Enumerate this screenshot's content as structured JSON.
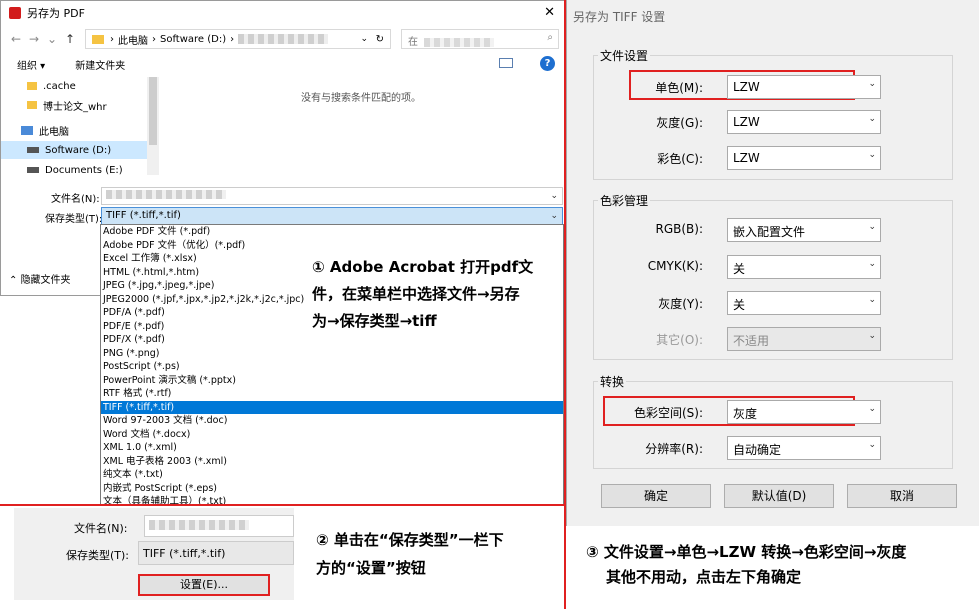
{
  "save_dialog": {
    "title": "另存为 PDF",
    "breadcrumb": [
      "此电脑",
      "Software (D:)"
    ],
    "search_prefix": "在",
    "organize": "组织",
    "new_folder": "新建文件夹",
    "help_glyph": "?",
    "tree": [
      ".cache",
      "博士论文_whr",
      "此电脑",
      "Software (D:)",
      "Documents (E:)"
    ],
    "empty_message": "没有与搜索条件匹配的项。",
    "filename_label": "文件名(N):",
    "filetype_label": "保存类型(T):",
    "filetype_value": "TIFF (*.tiff,*.tif)",
    "hide_folders": "隐藏文件夹",
    "options": [
      "Adobe PDF 文件 (*.pdf)",
      "Adobe PDF 文件（优化）(*.pdf)",
      "Excel 工作簿 (*.xlsx)",
      "HTML (*.html,*.htm)",
      "JPEG (*.jpg,*.jpeg,*.jpe)",
      "JPEG2000 (*.jpf,*.jpx,*.jp2,*.j2k,*.j2c,*.jpc)",
      "PDF/A (*.pdf)",
      "PDF/E (*.pdf)",
      "PDF/X (*.pdf)",
      "PNG (*.png)",
      "PostScript (*.ps)",
      "PowerPoint 演示文稿 (*.pptx)",
      "RTF 格式 (*.rtf)",
      "TIFF (*.tiff,*.tif)",
      "Word 97-2003 文档 (*.doc)",
      "Word 文档 (*.docx)",
      "XML 1.0 (*.xml)",
      "XML 电子表格 2003 (*.xml)",
      "纯文本 (*.txt)",
      "内嵌式 PostScript (*.eps)",
      "文本（具备辅助工具）(*.txt)"
    ],
    "selected_option": "TIFF (*.tiff,*.tif)"
  },
  "note1": {
    "line1": "① Adobe Acrobat 打开pdf文",
    "line2": "件，在菜单栏中选择文件→另存",
    "line3": "为→保存类型→tiff"
  },
  "sub_dialog": {
    "filename_label": "文件名(N):",
    "filetype_label": "保存类型(T):",
    "filetype_value": "TIFF (*.tiff,*.tif)",
    "settings_button": "设置(E)..."
  },
  "note2": {
    "line1": "② 单击在“保存类型”一栏下",
    "line2": "方的“设置”按钮"
  },
  "tiff_dialog": {
    "title": "另存为 TIFF 设置",
    "group_file": "文件设置",
    "mono_label": "单色(M):",
    "mono_value": "LZW",
    "gray_label": "灰度(G):",
    "gray_value": "LZW",
    "color_label": "彩色(C):",
    "color_value": "LZW",
    "group_color": "色彩管理",
    "rgb_label": "RGB(B):",
    "rgb_value": "嵌入配置文件",
    "cmyk_label": "CMYK(K):",
    "cmyk_value": "关",
    "gray2_label": "灰度(Y):",
    "gray2_value": "关",
    "other_label": "其它(O):",
    "other_value": "不适用",
    "group_convert": "转换",
    "colorspace_label": "色彩空间(S):",
    "colorspace_value": "灰度",
    "resolution_label": "分辨率(R):",
    "resolution_value": "自动确定",
    "ok": "确定",
    "default": "默认值(D)",
    "cancel": "取消"
  },
  "note3": {
    "line1": "③ 文件设置→单色→LZW  转换→色彩空间→灰度",
    "line2": "其他不用动，点击左下角确定"
  },
  "colors": {
    "highlight_red": "#e02020",
    "selected_blue": "#0078d7"
  }
}
